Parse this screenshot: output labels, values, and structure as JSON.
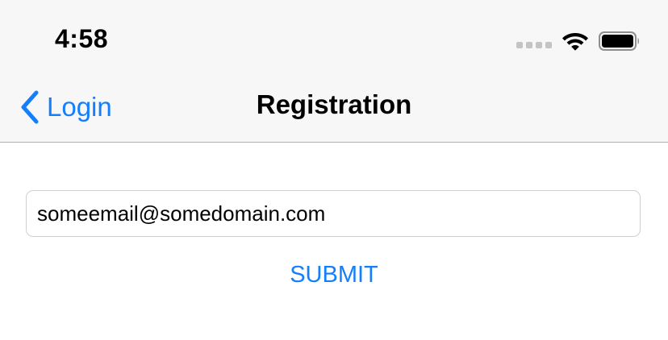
{
  "status_bar": {
    "time": "4:58",
    "icons": [
      "cellular-signal-icon",
      "wifi-icon",
      "battery-icon"
    ]
  },
  "nav_bar": {
    "back_label": "Login",
    "back_icon": "chevron-left-icon",
    "title": "Registration"
  },
  "form": {
    "email_value": "someemail@somedomain.com",
    "submit_label": "SUBMIT"
  },
  "colors": {
    "accent": "#147efb",
    "nav_background": "#f7f7f7",
    "divider": "#b2b2b2",
    "field_border": "#cfcfcf"
  }
}
